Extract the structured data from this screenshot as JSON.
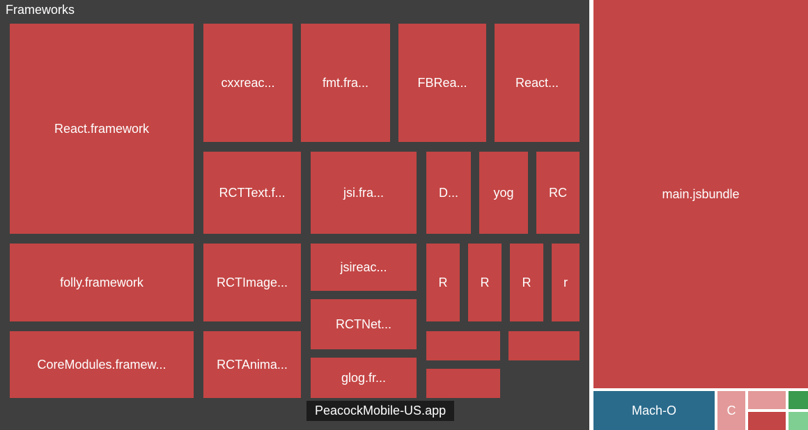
{
  "chart_data": {
    "type": "treemap",
    "root_label": "PeacockMobile-US.app",
    "children": [
      {
        "name": "Frameworks",
        "size_est": 2800,
        "children": [
          {
            "name": "React.framework",
            "size_est": 480
          },
          {
            "name": "folly.framework",
            "size_est": 190
          },
          {
            "name": "CoreModules.framew...",
            "size_est": 170
          },
          {
            "name": "cxxreac...",
            "size_est": 130
          },
          {
            "name": "fmt.fra...",
            "size_est": 130
          },
          {
            "name": "FBRea...",
            "size_est": 130
          },
          {
            "name": "React...",
            "size_est": 130
          },
          {
            "name": "RCTText.f...",
            "size_est": 110
          },
          {
            "name": "jsi.fra...",
            "size_est": 100
          },
          {
            "name": "D...",
            "size_est": 60
          },
          {
            "name": "yog",
            "size_est": 60
          },
          {
            "name": "RC",
            "size_est": 60
          },
          {
            "name": "RCTImage...",
            "size_est": 110
          },
          {
            "name": "RCTAnima...",
            "size_est": 90
          },
          {
            "name": "jsireac...",
            "size_est": 70
          },
          {
            "name": "RCTNet...",
            "size_est": 65
          },
          {
            "name": "glog.fr...",
            "size_est": 55
          },
          {
            "name": "R",
            "size_est": 40
          },
          {
            "name": "R",
            "size_est": 40
          },
          {
            "name": "R",
            "size_est": 40
          },
          {
            "name": "r",
            "size_est": 35
          },
          {
            "name": "",
            "size_est": 30
          },
          {
            "name": "",
            "size_est": 30
          },
          {
            "name": "",
            "size_est": 20
          }
        ]
      },
      {
        "name": "main.jsbundle",
        "size_est": 980
      },
      {
        "name": "Mach-O",
        "size_est": 100
      },
      {
        "name": "C",
        "size_est": 30
      },
      {
        "name": "",
        "size_est": 28,
        "color": "pink"
      },
      {
        "name": "",
        "size_est": 18,
        "color": "red"
      },
      {
        "name": "",
        "size_est": 15,
        "color": "green1"
      },
      {
        "name": "",
        "size_est": 12,
        "color": "green2"
      }
    ]
  },
  "labels": {
    "frameworks": "Frameworks",
    "app": "PeacockMobile-US.app",
    "main_jsbundle": "main.jsbundle",
    "macho": "Mach-O",
    "c": "C",
    "react_fw": "React.framework",
    "folly": "folly.framework",
    "coremod": "CoreModules.framew...",
    "cxxreac": "cxxreac...",
    "fmt": "fmt.fra...",
    "fbrea": "FBRea...",
    "react2": "React...",
    "rcttext": "RCTText.f...",
    "jsi": "jsi.fra...",
    "d": "D...",
    "yog": "yog",
    "rc": "RC",
    "rctimage": "RCTImage...",
    "rctanima": "RCTAnima...",
    "jsireac": "jsireac...",
    "rctnet": "RCTNet...",
    "glog": "glog.fr...",
    "r1": "R",
    "r2": "R",
    "r3": "R",
    "r4": "r"
  }
}
